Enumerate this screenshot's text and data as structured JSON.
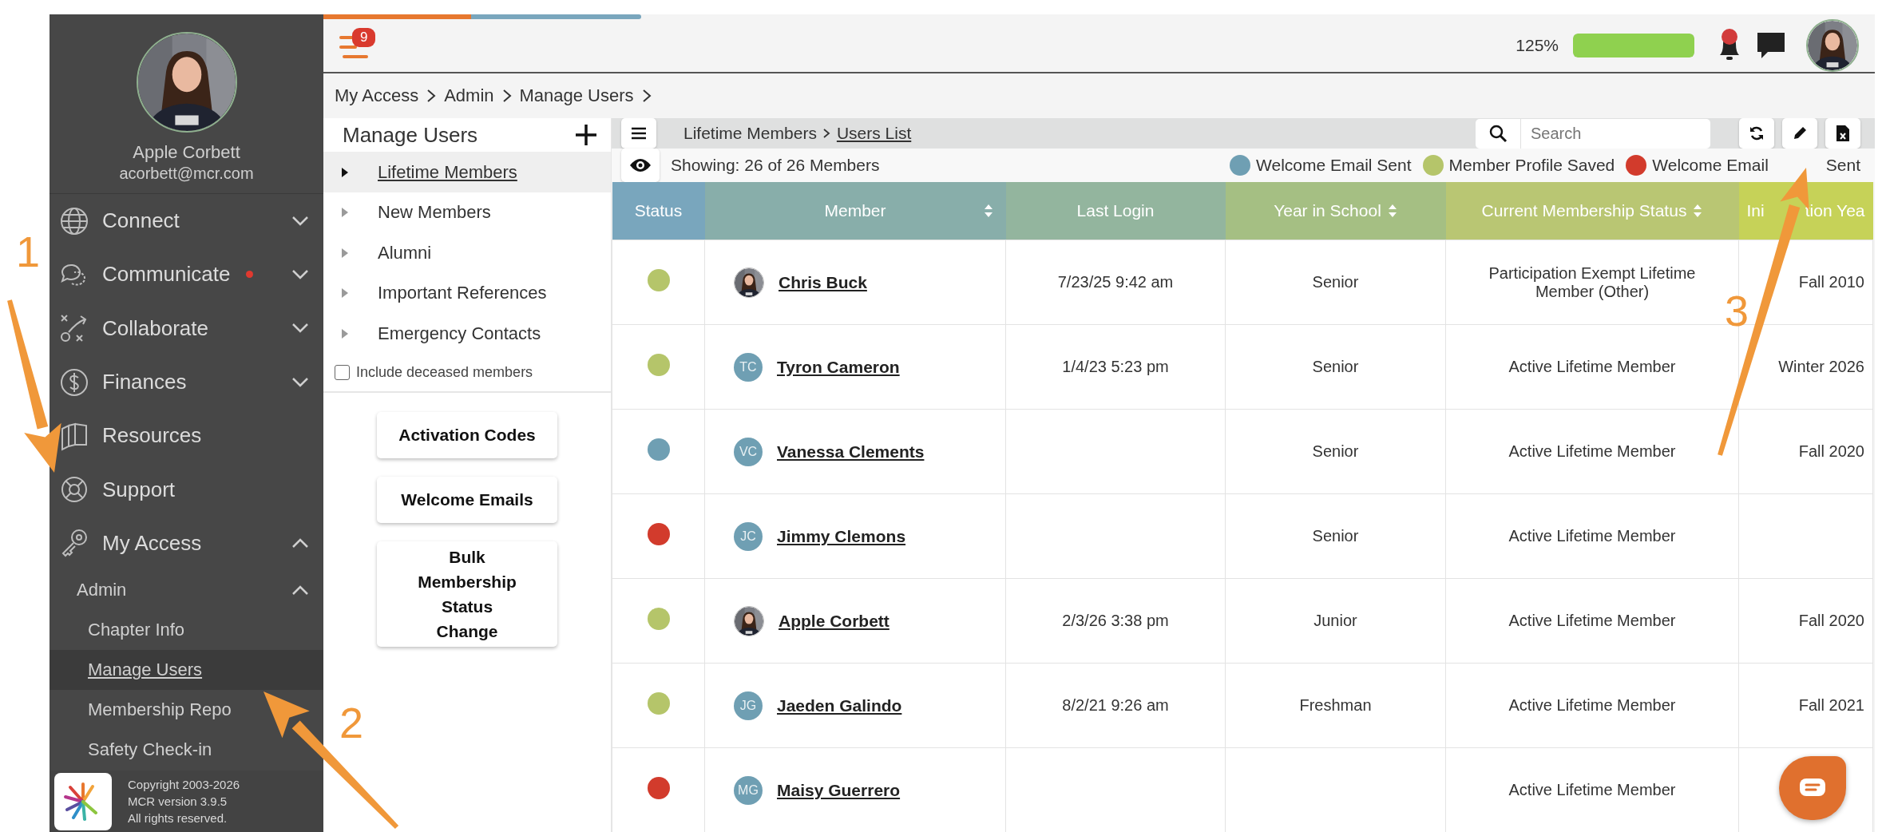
{
  "sidebar": {
    "user": {
      "name": "Apple Corbett",
      "email": "acorbett@mcr.com"
    },
    "nav": [
      {
        "label": "Connect",
        "expanded": false,
        "alert": false
      },
      {
        "label": "Communicate",
        "expanded": false,
        "alert": true
      },
      {
        "label": "Collaborate",
        "expanded": false,
        "alert": false
      },
      {
        "label": "Finances",
        "expanded": false,
        "alert": false
      },
      {
        "label": "Resources",
        "alert": false
      },
      {
        "label": "Support",
        "alert": false
      },
      {
        "label": "My Access",
        "expanded": true,
        "alert": false,
        "children": [
          {
            "label": "Admin",
            "expanded": true,
            "children": [
              {
                "label": "Chapter Info",
                "selected": false
              },
              {
                "label": "Manage Users",
                "selected": true
              },
              {
                "label": "Membership Repo",
                "selected": false
              },
              {
                "label": "Safety Check-in",
                "selected": false
              }
            ]
          }
        ]
      }
    ],
    "footer": [
      "Copyright 2003-2026",
      "MCR version 3.9.5",
      "All rights reserved."
    ]
  },
  "topbar": {
    "notification_count": "9",
    "usage": {
      "reading": "125%",
      "level": 1
    },
    "bell_alert": true
  },
  "breadcrumb": [
    "My Access",
    "Admin",
    "Manage Users"
  ],
  "manage_panel": {
    "title": "Manage Users",
    "groups": [
      {
        "label": "Lifetime Members",
        "selected": true
      },
      {
        "label": "New Members",
        "selected": false
      },
      {
        "label": "Alumni",
        "selected": false
      },
      {
        "label": "Important References",
        "selected": false
      },
      {
        "label": "Emergency Contacts",
        "selected": false
      }
    ],
    "include_deceased": {
      "label": "Include deceased members",
      "checked": false
    },
    "buttons": [
      "Activation Codes",
      "Welcome Emails",
      "Bulk Membership Status Change"
    ]
  },
  "users_list": {
    "crumb": {
      "parent": "Lifetime Members",
      "current": "Users List"
    },
    "search": {
      "placeholder": "Search"
    },
    "showing": "Showing: 26 of 26 Members",
    "legend": [
      {
        "label": "Welcome Email Sent",
        "color": "#6f9fb3"
      },
      {
        "label": "Member Profile Saved",
        "color": "#b5c56a"
      },
      {
        "label": "Welcome Email",
        "label_after_arrow": "Sent",
        "color": "#d23b2c"
      }
    ],
    "columns": [
      {
        "label": "Status",
        "sortable": false
      },
      {
        "label": "Member",
        "sortable": true
      },
      {
        "label": "Last Login",
        "sortable": false
      },
      {
        "label": "Year in School",
        "sortable": true
      },
      {
        "label": "Current Membership Status",
        "sortable": true
      },
      {
        "label": "Ini",
        "label_after_arrow": "tion Yea",
        "sortable": false
      }
    ],
    "rows": [
      {
        "color": "#b5c56a",
        "member": "Chris Buck",
        "last_login": "7/23/25 9:42 am",
        "year": "Senior",
        "membership": "Participation Exempt Lifetime Member (Other)",
        "initiation": "Fall 2010"
      },
      {
        "color": "#b5c56a",
        "member": "Tyron Cameron",
        "avatar": {
          "kind": "initials",
          "initials": "TC"
        },
        "last_login": "1/4/23 5:23 pm",
        "year": "Senior",
        "membership": "Active Lifetime Member",
        "initiation": "Winter 2026"
      },
      {
        "color": "#6f9fb3",
        "member": "Vanessa Clements",
        "avatar": {
          "kind": "initials",
          "initials": "VC"
        },
        "year": "Senior",
        "membership": "Active Lifetime Member",
        "initiation": "Fall 2020"
      },
      {
        "color": "#d23b2c",
        "member": "Jimmy Clemons",
        "avatar": {
          "kind": "initials",
          "initials": "JC"
        },
        "year": "Senior",
        "membership": "Active Lifetime Member"
      },
      {
        "color": "#b5c56a",
        "member": "Apple Corbett",
        "last_login": "2/3/26 3:38 pm",
        "year": "Junior",
        "membership": "Active Lifetime Member",
        "initiation": "Fall 2020"
      },
      {
        "color": "#b5c56a",
        "member": "Jaeden Galindo",
        "avatar": {
          "kind": "initials",
          "initials": "JG"
        },
        "last_login": "8/2/21 9:26 am",
        "year": "Freshman",
        "membership": "Active Lifetime Member",
        "initiation": "Fall 2021"
      },
      {
        "color": "#d23b2c",
        "member": "Maisy Guerrero",
        "avatar": {
          "kind": "initials",
          "initials": "MG"
        },
        "membership": "Active Lifetime Member"
      }
    ]
  },
  "annotations": [
    {
      "number": "1"
    },
    {
      "number": "2"
    },
    {
      "number": "3"
    }
  ]
}
